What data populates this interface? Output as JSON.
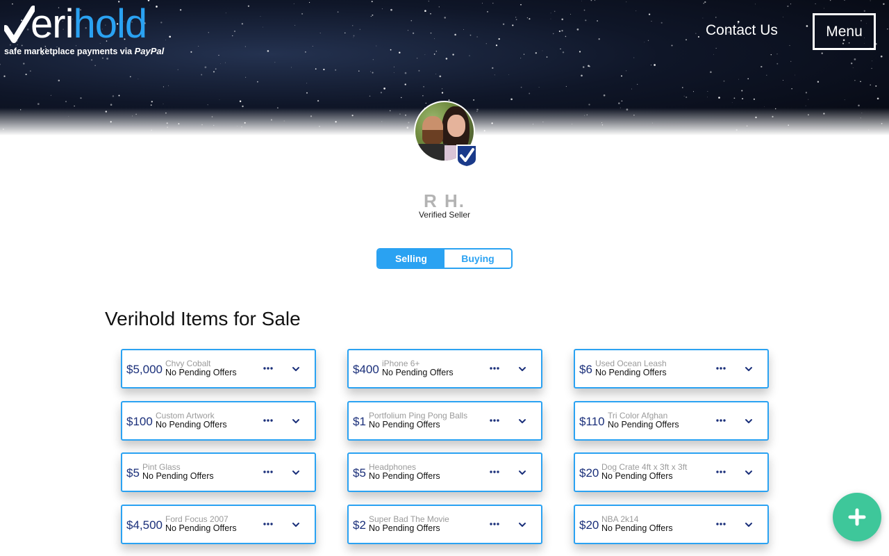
{
  "header": {
    "logo_prefix": "V",
    "logo_white": "eri",
    "logo_blue": "hold",
    "tagline": "safe marketplace payments via",
    "tagline_brand": "PayPal",
    "contact_label": "Contact Us",
    "menu_label": "Menu"
  },
  "profile": {
    "name": "R H.",
    "role": "Verified Seller",
    "badge_icon": "verified-check-icon"
  },
  "tabs": {
    "selling": "Selling",
    "buying": "Buying",
    "active": "Selling"
  },
  "section_title": "Verihold Items for Sale",
  "items": [
    {
      "price": "$5,000",
      "name": "Chvy Cobalt",
      "status": "No Pending Offers"
    },
    {
      "price": "$400",
      "name": "iPhone 6+",
      "status": "No Pending Offers"
    },
    {
      "price": "$6",
      "name": "Used Ocean Leash",
      "status": "No Pending Offers"
    },
    {
      "price": "$100",
      "name": "Custom Artwork",
      "status": "No Pending Offers"
    },
    {
      "price": "$1",
      "name": "Portfolium Ping Pong Balls",
      "status": "No Pending Offers"
    },
    {
      "price": "$110",
      "name": "Tri Color Afghan",
      "status": "No Pending Offers"
    },
    {
      "price": "$5",
      "name": "Pint Glass",
      "status": "No Pending Offers"
    },
    {
      "price": "$5",
      "name": "Headphones",
      "status": "No Pending Offers"
    },
    {
      "price": "$20",
      "name": "Dog Crate 4ft x 3ft x 3ft",
      "status": "No Pending Offers"
    },
    {
      "price": "$4,500",
      "name": "Ford Focus 2007",
      "status": "No Pending Offers"
    },
    {
      "price": "$2",
      "name": "Super Bad The Movie",
      "status": "No Pending Offers"
    },
    {
      "price": "$20",
      "name": "NBA 2k14",
      "status": "No Pending Offers"
    }
  ],
  "fab_icon": "plus-icon",
  "colors": {
    "accent": "#2aa2f2",
    "price": "#1a2f7a",
    "fab": "#3ec79a"
  }
}
